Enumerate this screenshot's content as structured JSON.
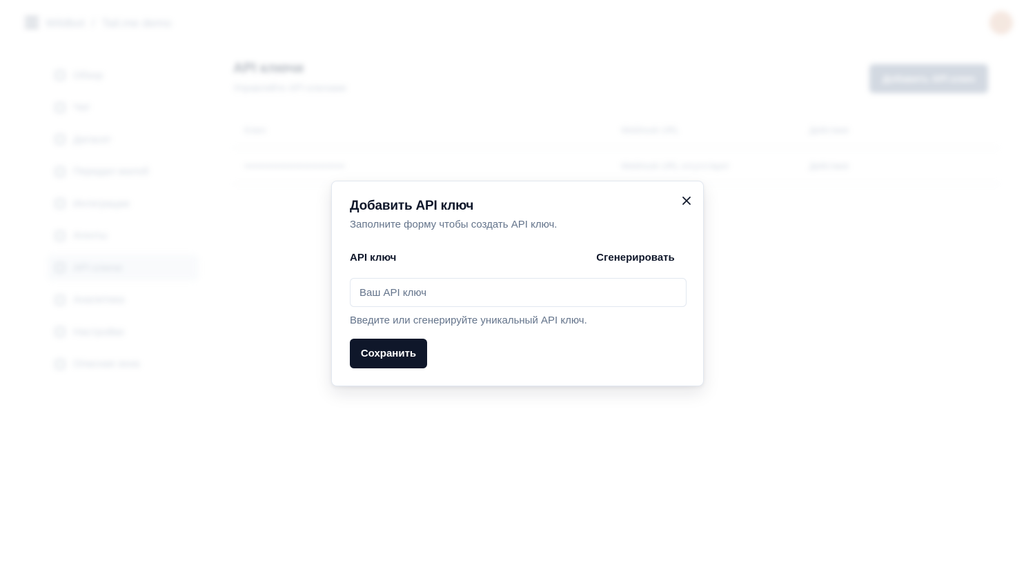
{
  "header": {
    "breadcrumb": [
      "Wildbot",
      "Tail.me demo"
    ],
    "breadcrumb_separator": "/"
  },
  "sidebar": {
    "items": [
      {
        "label": "Обзор",
        "icon": "home-icon"
      },
      {
        "label": "Чат",
        "icon": "chat-icon"
      },
      {
        "label": "Датасет",
        "icon": "dataset-icon"
      },
      {
        "label": "Передал жалоб",
        "icon": "forward-icon"
      },
      {
        "label": "Интеграции",
        "icon": "integrations-icon"
      },
      {
        "label": "Агенты",
        "icon": "agents-icon"
      },
      {
        "label": "API ключи",
        "icon": "key-icon",
        "active": true
      },
      {
        "label": "Аналитика",
        "icon": "analytics-icon"
      },
      {
        "label": "Настройки",
        "icon": "settings-icon"
      },
      {
        "label": "Опасная зона",
        "icon": "warning-icon"
      }
    ]
  },
  "main": {
    "title": "API ключи",
    "subtitle": "Управляйте API ключами",
    "add_button": "Добавить API ключ",
    "table": {
      "headers": [
        "Ключ",
        "Webhook URL",
        "Действия"
      ],
      "rows": [
        [
          "••••••••••••••••••••••••••••••••",
          "Webhook URL отсутствует",
          "Действия"
        ]
      ]
    }
  },
  "modal": {
    "title": "Добавить API ключ",
    "description": "Заполните форму чтобы создать API ключ.",
    "field_label": "API ключ",
    "generate_label": "Сгенерировать",
    "input_placeholder": "Ваш API ключ",
    "input_value": "",
    "helper_text": "Введите или сгенерируйте уникальный API ключ.",
    "save_label": "Сохранить",
    "close_icon": "close-icon"
  },
  "colors": {
    "primary": "#0f172a",
    "muted_text": "#64748b",
    "border": "#e2e8f0"
  }
}
